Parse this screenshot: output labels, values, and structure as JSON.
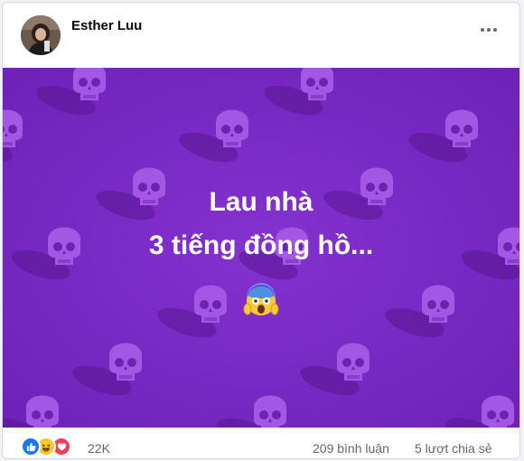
{
  "post": {
    "author": "Esther Luu",
    "image_text_line1": "Lau nhà",
    "image_text_line2": "3 tiếng đồng hồ..."
  },
  "image_icons": {
    "center": "face-screaming-in-fear-icon",
    "pattern": "skull-icon"
  },
  "reactions": {
    "icons": [
      "like-icon",
      "haha-icon",
      "love-icon"
    ],
    "count": "22K"
  },
  "stats": {
    "comments": "209 bình luận",
    "shares": "5 lượt chia sẻ"
  },
  "colors": {
    "image_background": "#7c2bc7",
    "skull": "#a457e2",
    "like": "#1877f2",
    "haha": "#f7c928",
    "love": "#f33e58"
  }
}
